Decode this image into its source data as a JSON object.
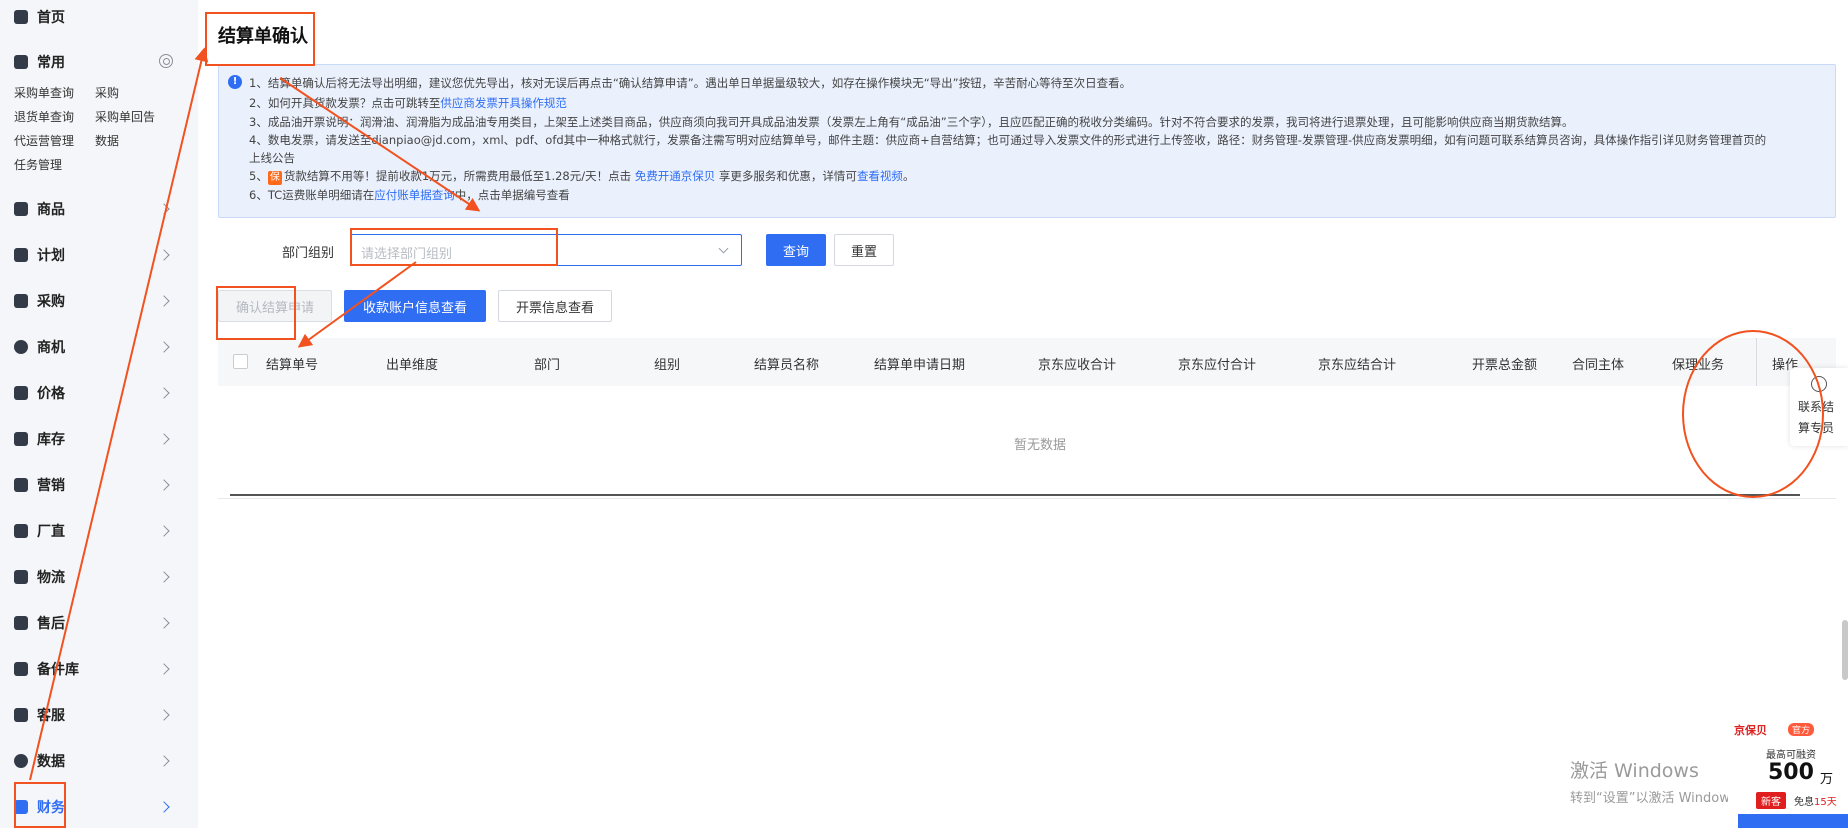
{
  "sidebar": {
    "home": "首页",
    "common": "常用",
    "quick_links": [
      "采购单查询",
      "采购",
      "退货单查询",
      "采购单回告",
      "代运营管理",
      "数据",
      "任务管理"
    ],
    "nav": [
      "商品",
      "计划",
      "采购",
      "商机",
      "价格",
      "库存",
      "营销",
      "厂直",
      "物流",
      "售后",
      "备件库",
      "客服",
      "数据",
      "财务"
    ],
    "active": "财务"
  },
  "page": {
    "title": "结算单确认"
  },
  "notice": {
    "l1": "1、结算单确认后将无法导出明细，建议您优先导出，核对无误后再点击“确认结算申请”。遇出单日单据量级较大，如存在操作模块无“导出”按钮，辛苦耐心等待至次日查看。",
    "l2_pre": "2、如何开具货款发票？点击可跳转至",
    "l2_link": "供应商发票开具操作规范",
    "l3": "3、成品油开票说明：润滑油、润滑脂为成品油专用类目，上架至上述类目商品，供应商须向我司开具成品油发票（发票左上角有“成品油”三个字），且应匹配正确的税收分类编码。针对不符合要求的发票，我司将进行退票处理，且可能影响供应商当期货款结算。",
    "l4a": "4、数电发票，请发送至dianpiao@jd.com，xml、pdf、ofd其中一种格式就行，发票备注需写明对应结算单号，邮件主题：供应商+自营结算；也可通过导入发票文件的形式进行上传签收，路径：财务管理-发票管理-供应商发票明细，如有问题可联系结算员咨询，具体操作指引详见财务管理首页的",
    "l4b": "上线公告",
    "l5_badge": "保",
    "l5_pre": "货款结算不用等！提前收款1万元，所需费用最低至1.28元/天！点击 ",
    "l5_link1": "免费开通京保贝",
    "l5_mid": " 享更多服务和优惠，详情可",
    "l5_link2": "查看视频",
    "l5_end": "。",
    "l6_pre": "6、TC运费账单明细请在",
    "l6_link": "应付账单据查询",
    "l6_post": "中，点击单据编号查看"
  },
  "filter": {
    "label": "部门组别",
    "placeholder": "请选择部门组别",
    "query": "查询",
    "reset": "重置"
  },
  "actions": {
    "confirm": "确认结算申请",
    "account": "收款账户信息查看",
    "invoice": "开票信息查看"
  },
  "table": {
    "columns": [
      "结算单号",
      "出单维度",
      "部门",
      "组别",
      "结算员名称",
      "结算单申请日期",
      "京东应收合计",
      "京东应付合计",
      "京东应结合计",
      "开票总金额",
      "合同主体",
      "保理业务",
      "操作"
    ],
    "empty": "暂无数据"
  },
  "float_contact": {
    "line1": "联系结",
    "line2": "算专员"
  },
  "watermark": {
    "line1": "激活 Windows",
    "line2": "转到“设置”以激活 Windows。"
  },
  "ad": {
    "brand": "京保贝",
    "tag": "官方",
    "label": "最高可融资",
    "amount": "500",
    "unit": "万",
    "badge": "新客",
    "free_pre": "免息",
    "free_days": "15天"
  }
}
